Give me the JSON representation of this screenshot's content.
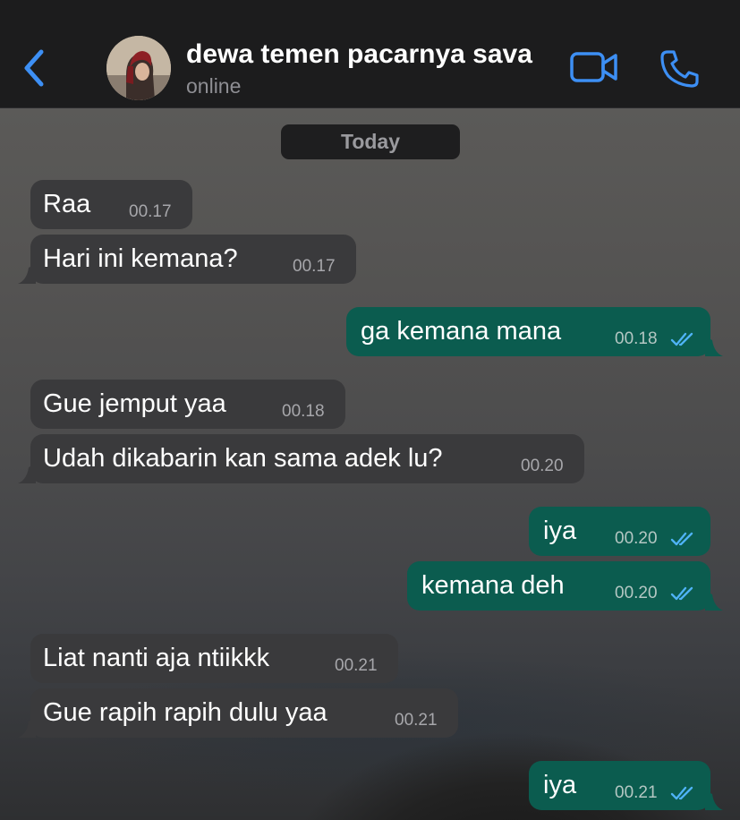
{
  "header": {
    "contact_name": "dewa temen pacarnya sava",
    "status": "online"
  },
  "chat": {
    "date_label": "Today",
    "messages": [
      {
        "direction": "in",
        "text": "Raa",
        "time": "00.17"
      },
      {
        "direction": "in",
        "text": "Hari ini kemana?",
        "time": "00.17"
      },
      {
        "direction": "out",
        "text": "ga kemana mana",
        "time": "00.18",
        "status": "read"
      },
      {
        "direction": "in",
        "text": "Gue jemput yaa",
        "time": "00.18"
      },
      {
        "direction": "in",
        "text": "Udah dikabarin kan sama adek lu?",
        "time": "00.20"
      },
      {
        "direction": "out",
        "text": "iya",
        "time": "00.20",
        "status": "read"
      },
      {
        "direction": "out",
        "text": "kemana deh",
        "time": "00.20",
        "status": "read"
      },
      {
        "direction": "in",
        "text": "Liat nanti aja ntiikkk",
        "time": "00.21"
      },
      {
        "direction": "in",
        "text": "Gue rapih rapih dulu yaa",
        "time": "00.21"
      },
      {
        "direction": "out",
        "text": "iya",
        "time": "00.21",
        "status": "read"
      }
    ]
  },
  "colors": {
    "accent": "#3d8ff4",
    "incoming_bubble": "#3a3a3c",
    "outgoing_bubble": "#0b5c4f",
    "header_bg": "#1c1c1d"
  },
  "icons": {
    "back": "chevron-left-icon",
    "video": "video-camera-icon",
    "call": "phone-icon",
    "read_receipt": "double-check-icon"
  }
}
